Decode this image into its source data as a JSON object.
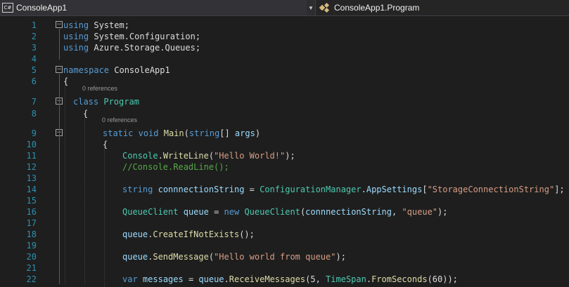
{
  "navigation": {
    "project_icon": "csharp-project-icon",
    "project_label": "ConsoleApp1",
    "member_icon": "class-icon",
    "member_label": "ConsoleApp1.Program"
  },
  "editor": {
    "line_numbers": [
      "1",
      "2",
      "3",
      "4",
      "5",
      "6",
      "7",
      "8",
      "9",
      "10",
      "11",
      "12",
      "13",
      "14",
      "15",
      "16",
      "17",
      "18",
      "19",
      "20",
      "21",
      "22"
    ],
    "codelens": [
      "0 references",
      "0 references"
    ],
    "lines": [
      [
        [
          "kw",
          "using"
        ],
        [
          "id",
          " System;"
        ]
      ],
      [
        [
          "kw",
          "using"
        ],
        [
          "id",
          " System.Configuration;"
        ]
      ],
      [
        [
          "kw",
          "using"
        ],
        [
          "id",
          " Azure.Storage.Queues;"
        ]
      ],
      [],
      [
        [
          "kw",
          "namespace"
        ],
        [
          "id",
          " ConsoleApp1"
        ]
      ],
      [
        [
          "id",
          "{"
        ]
      ],
      [
        [
          "kw",
          "class"
        ],
        [
          "id",
          " "
        ],
        [
          "ty",
          "Program"
        ]
      ],
      [
        [
          "id",
          "{"
        ]
      ],
      [
        [
          "kw",
          "static"
        ],
        [
          "id",
          " "
        ],
        [
          "kw",
          "void"
        ],
        [
          "id",
          " "
        ],
        [
          "md",
          "Main"
        ],
        [
          "id",
          "("
        ],
        [
          "kw",
          "string"
        ],
        [
          "id",
          "[] "
        ],
        [
          "vr",
          "args"
        ],
        [
          "id",
          ")"
        ]
      ],
      [
        [
          "id",
          "{"
        ]
      ],
      [
        [
          "ty",
          "Console"
        ],
        [
          "id",
          "."
        ],
        [
          "md",
          "WriteLine"
        ],
        [
          "id",
          "("
        ],
        [
          "str",
          "\"Hello World!\""
        ],
        [
          "id",
          ");"
        ]
      ],
      [
        [
          "cm",
          "//Console.ReadLine();"
        ]
      ],
      [],
      [
        [
          "kw",
          "string"
        ],
        [
          "id",
          " "
        ],
        [
          "vr",
          "connnectionString"
        ],
        [
          "id",
          " = "
        ],
        [
          "ty",
          "ConfigurationManager"
        ],
        [
          "id",
          "."
        ],
        [
          "vr",
          "AppSettings"
        ],
        [
          "id",
          "["
        ],
        [
          "str",
          "\"StorageConnectionString\""
        ],
        [
          "id",
          "];"
        ]
      ],
      [],
      [
        [
          "ty",
          "QueueClient"
        ],
        [
          "id",
          " "
        ],
        [
          "vr",
          "queue"
        ],
        [
          "id",
          " = "
        ],
        [
          "kw",
          "new"
        ],
        [
          "id",
          " "
        ],
        [
          "ty",
          "QueueClient"
        ],
        [
          "id",
          "("
        ],
        [
          "vr",
          "connnectionString"
        ],
        [
          "id",
          ", "
        ],
        [
          "str",
          "\"queue\""
        ],
        [
          "id",
          ");"
        ]
      ],
      [],
      [
        [
          "vr",
          "queue"
        ],
        [
          "id",
          "."
        ],
        [
          "md",
          "CreateIfNotExists"
        ],
        [
          "id",
          "();"
        ]
      ],
      [],
      [
        [
          "vr",
          "queue"
        ],
        [
          "id",
          "."
        ],
        [
          "md",
          "SendMessage"
        ],
        [
          "id",
          "("
        ],
        [
          "str",
          "\"Hello world from queue\""
        ],
        [
          "id",
          ");"
        ]
      ],
      [],
      [
        [
          "kw",
          "var"
        ],
        [
          "id",
          " "
        ],
        [
          "vr",
          "messages"
        ],
        [
          "id",
          " = "
        ],
        [
          "vr",
          "queue"
        ],
        [
          "id",
          "."
        ],
        [
          "md",
          "ReceiveMessages"
        ],
        [
          "id",
          "(5, "
        ],
        [
          "ty",
          "TimeSpan"
        ],
        [
          "id",
          "."
        ],
        [
          "md",
          "FromSeconds"
        ],
        [
          "id",
          "(60));"
        ]
      ]
    ]
  }
}
